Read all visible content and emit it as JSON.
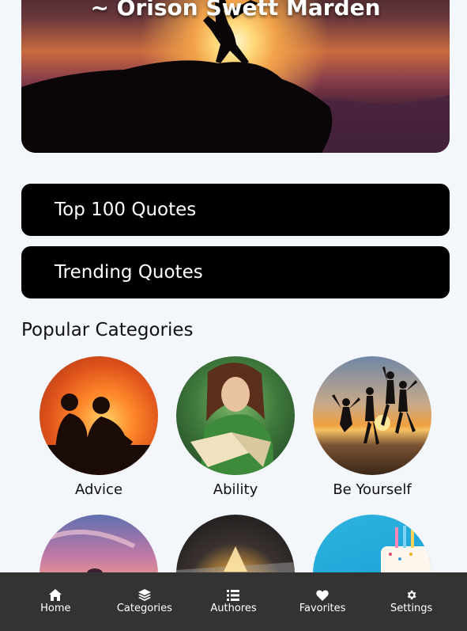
{
  "hero": {
    "author": "~ Orison Swett Marden"
  },
  "list_buttons": {
    "top100_label": "Top 100 Quotes",
    "trending_label": "Trending Quotes"
  },
  "section": {
    "popular_categories_title": "Popular Categories"
  },
  "categories": [
    {
      "label": "Advice"
    },
    {
      "label": "Ability"
    },
    {
      "label": "Be Yourself"
    },
    {
      "label": ""
    },
    {
      "label": ""
    },
    {
      "label": ""
    }
  ],
  "bottom_nav": {
    "items": [
      {
        "label": "Home",
        "icon": "home-icon"
      },
      {
        "label": "Categories",
        "icon": "layers-icon"
      },
      {
        "label": "Authores",
        "icon": "list-icon"
      },
      {
        "label": "Favorites",
        "icon": "heart-icon"
      },
      {
        "label": "Settings",
        "icon": "gear-icon"
      }
    ]
  },
  "colors": {
    "background": "#f3f6fb",
    "button_bg": "#000000",
    "nav_bg": "#333333",
    "text_light": "#ffffff"
  }
}
